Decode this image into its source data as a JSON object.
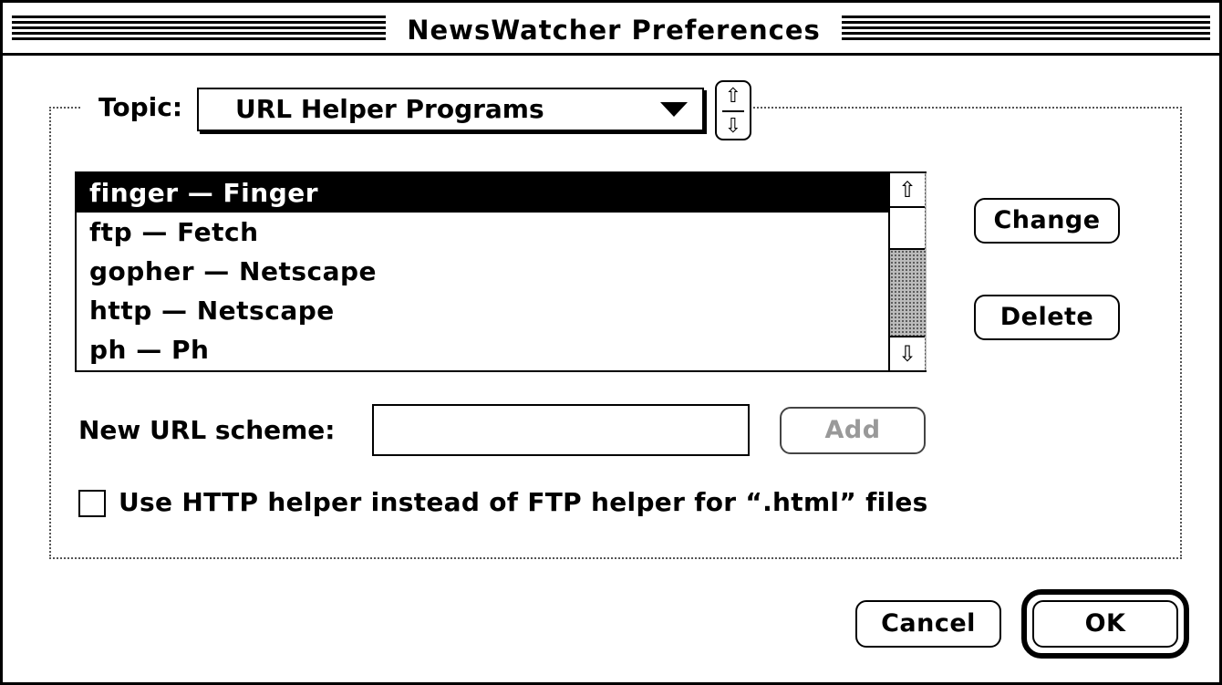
{
  "window": {
    "title": "NewsWatcher Preferences"
  },
  "topic": {
    "label": "Topic:",
    "selected": "URL Helper Programs"
  },
  "helpers": {
    "items": [
      {
        "label": "finger — Finger",
        "selected": true
      },
      {
        "label": "ftp — Fetch",
        "selected": false
      },
      {
        "label": "gopher — Netscape",
        "selected": false
      },
      {
        "label": "http — Netscape",
        "selected": false
      },
      {
        "label": "ph — Ph",
        "selected": false
      }
    ]
  },
  "buttons": {
    "change": "Change",
    "delete": "Delete",
    "add": "Add",
    "cancel": "Cancel",
    "ok": "OK"
  },
  "new_scheme": {
    "label": "New URL scheme:",
    "value": ""
  },
  "option": {
    "label": "Use HTTP helper instead of FTP helper for “.html” files",
    "checked": false
  },
  "icons": {
    "popup": "triangle-down",
    "stepper_up": "up-arrow",
    "stepper_down": "down-arrow"
  }
}
